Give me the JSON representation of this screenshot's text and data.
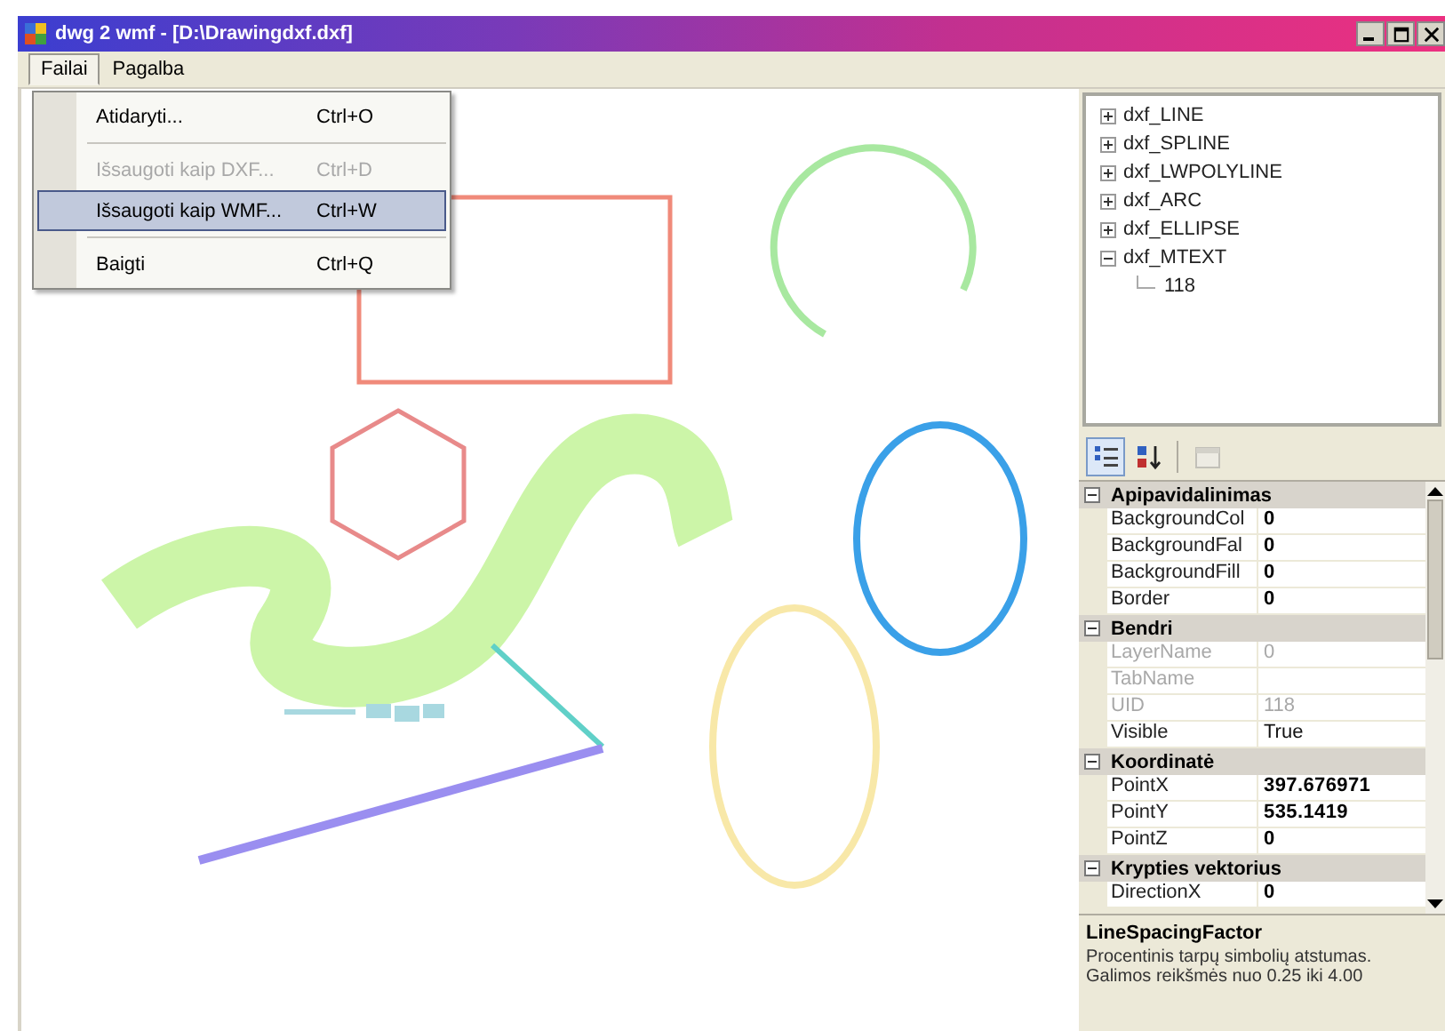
{
  "window": {
    "title": "dwg 2 wmf - [D:\\Drawingdxf.dxf]"
  },
  "menu": [
    {
      "label": "Failai",
      "selected": true
    },
    {
      "label": "Pagalba",
      "selected": false
    }
  ],
  "dropdown": [
    {
      "kind": "item",
      "label": "Atidaryti...",
      "shortcut": "Ctrl+O",
      "disabled": false,
      "selected": false
    },
    {
      "kind": "separator"
    },
    {
      "kind": "item",
      "label": "Išsaugoti kaip DXF...",
      "shortcut": "Ctrl+D",
      "disabled": true,
      "selected": false
    },
    {
      "kind": "item",
      "label": "Išsaugoti kaip WMF...",
      "shortcut": "Ctrl+W",
      "disabled": false,
      "selected": true
    },
    {
      "kind": "separator"
    },
    {
      "kind": "item",
      "label": "Baigti",
      "shortcut": "Ctrl+Q",
      "disabled": false,
      "selected": false
    }
  ],
  "tree": [
    {
      "label": "dxf_LINE",
      "expanded": false
    },
    {
      "label": "dxf_SPLINE",
      "expanded": false
    },
    {
      "label": "dxf_LWPOLYLINE",
      "expanded": false
    },
    {
      "label": "dxf_ARC",
      "expanded": false
    },
    {
      "label": "dxf_ELLIPSE",
      "expanded": false
    },
    {
      "label": "dxf_MTEXT",
      "expanded": true,
      "children": [
        {
          "label": "118"
        }
      ]
    }
  ],
  "property_toolbar": [
    {
      "kind": "categorized",
      "selected": true,
      "disabled": false
    },
    {
      "kind": "alphabetical",
      "selected": false,
      "disabled": false
    },
    {
      "kind": "pages",
      "selected": false,
      "disabled": true
    }
  ],
  "properties": [
    {
      "category": "Apipavidalinimas",
      "expanded": true,
      "rows": [
        {
          "name": "BackgroundCol",
          "value": "0",
          "disabled": false,
          "modified": true
        },
        {
          "name": "BackgroundFal",
          "value": "0",
          "disabled": false,
          "modified": true
        },
        {
          "name": "BackgroundFill",
          "value": "0",
          "disabled": false,
          "modified": true
        },
        {
          "name": "Border",
          "value": "0",
          "disabled": false,
          "modified": true
        }
      ]
    },
    {
      "category": "Bendri",
      "expanded": true,
      "rows": [
        {
          "name": "LayerName",
          "value": "0",
          "disabled": true,
          "modified": false
        },
        {
          "name": "TabName",
          "disabled": true,
          "modified": false
        },
        {
          "name": "UID",
          "value": "118",
          "disabled": true,
          "modified": false
        },
        {
          "name": "Visible",
          "value": "True",
          "disabled": false,
          "modified": false
        }
      ]
    },
    {
      "category": "Koordinatė",
      "expanded": true,
      "rows": [
        {
          "name": "PointX",
          "value": "397.676971",
          "disabled": false,
          "modified": true
        },
        {
          "name": "PointY",
          "value": "535.1419",
          "disabled": false,
          "modified": true
        },
        {
          "name": "PointZ",
          "value": "0",
          "disabled": false,
          "modified": true
        }
      ]
    },
    {
      "category": "Krypties vektorius",
      "expanded": true,
      "rows": [
        {
          "name": "DirectionX",
          "value": "0",
          "disabled": false,
          "modified": true
        }
      ]
    }
  ],
  "description": {
    "title": "LineSpacingFactor",
    "lines": [
      "Procentinis tarpų simbolių atstumas.",
      "Galimos reikšmės nuo 0.25 iki 4.00"
    ]
  }
}
